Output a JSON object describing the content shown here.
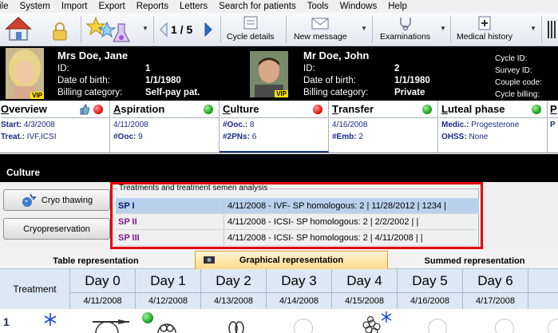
{
  "menu": [
    "File",
    "System",
    "Import",
    "Export",
    "Reports",
    "Letters",
    "Search for patients",
    "Tools",
    "Windows",
    "Help"
  ],
  "toolbar": {
    "pager": "1 / 5",
    "cycle_details": "Cycle details",
    "new_message": "New message",
    "examinations": "Examinations",
    "medical_history": "Medical history"
  },
  "patient_female": {
    "name": "Mrs Doe, Jane",
    "id_label": "ID:",
    "id_value": "1",
    "dob_label": "Date of birth:",
    "dob_value": "1/1/1980",
    "billing_label": "Billing category:",
    "billing_value": "Self-pay pat.",
    "vip": "VIP"
  },
  "patient_male": {
    "name": "Mr Doe, John",
    "id_label": "ID:",
    "id_value": "2",
    "dob_label": "Date of birth:",
    "dob_value": "1/1/1980",
    "billing_label": "Billing category:",
    "billing_value": "Private",
    "vip": "VIP"
  },
  "cycle_info": {
    "cycle_id": "Cycle ID:",
    "survey_id": "Survey ID:",
    "couple_code": "Couple code:",
    "cycle_billing": "Cycle billing:"
  },
  "phases": [
    {
      "title": "Overview",
      "first": "O",
      "rest": "verview",
      "status": "red",
      "l1k": "Start:",
      "l1v": "4/3/2008",
      "l2k": "Treat.:",
      "l2v": "IVF,ICSI"
    },
    {
      "title": "Aspiration",
      "first": "A",
      "rest": "spiration",
      "status": "green",
      "l1k": "",
      "l1v": "4/11/2008",
      "l2k": "#Ooc:",
      "l2v": "9"
    },
    {
      "title": "Culture",
      "first": "C",
      "rest": "ulture",
      "status": "red",
      "l1k": "#Ooc.:",
      "l1v": "8",
      "l2k": "#2PNs:",
      "l2v": "6"
    },
    {
      "title": "Transfer",
      "first": "T",
      "rest": "ransfer",
      "status": "green",
      "l1k": "",
      "l1v": "4/16/2008",
      "l2k": "#Emb:",
      "l2v": "2"
    },
    {
      "title": "Luteal phase",
      "first": "L",
      "rest": "uteal phase",
      "status": "green",
      "l1k": "Medic.:",
      "l1v": "Progesterone",
      "l2k": "OHSS:",
      "l2v": "None"
    },
    {
      "title": "P",
      "first": "P",
      "rest": "",
      "status": "none",
      "l1k": "P",
      "l1v": "",
      "l2k": "",
      "l2v": ""
    }
  ],
  "section_title": "Culture",
  "buttons": {
    "cryo_thawing": "Cryo thawing",
    "cryopreservation": "Cryopreservation"
  },
  "semen": {
    "legend": "Treatments and treatment semen analysis",
    "rows": [
      {
        "id": "SP I",
        "text": "4/11/2008 - IVF- SP homologous: 2 | 11/28/2012 | 1234 |"
      },
      {
        "id": "SP II",
        "text": "4/11/2008 - ICSI- SP homologous: 2 | 2/2/2002 |  |"
      },
      {
        "id": "SP III",
        "text": "4/11/2008 - ICSI- SP homologous: 2 | 4/11/2008 |  |"
      }
    ]
  },
  "tabs": [
    "Table representation",
    "Graphical representation",
    "Summed representation"
  ],
  "grid": {
    "treatment_label": "Treatment",
    "days": [
      {
        "name": "Day 0",
        "date": "4/11/2008"
      },
      {
        "name": "Day 1",
        "date": "4/12/2008"
      },
      {
        "name": "Day 2",
        "date": "4/13/2008"
      },
      {
        "name": "Day 3",
        "date": "4/14/2008"
      },
      {
        "name": "Day 4",
        "date": "4/15/2008"
      },
      {
        "name": "Day 5",
        "date": "4/16/2008"
      },
      {
        "name": "Day 6",
        "date": "4/17/2008"
      }
    ],
    "row_number": "1"
  },
  "colors": {
    "accent_blue": "#1a2a8a",
    "highlight_red": "#e60000",
    "selected_row": "#b9d1ec"
  }
}
